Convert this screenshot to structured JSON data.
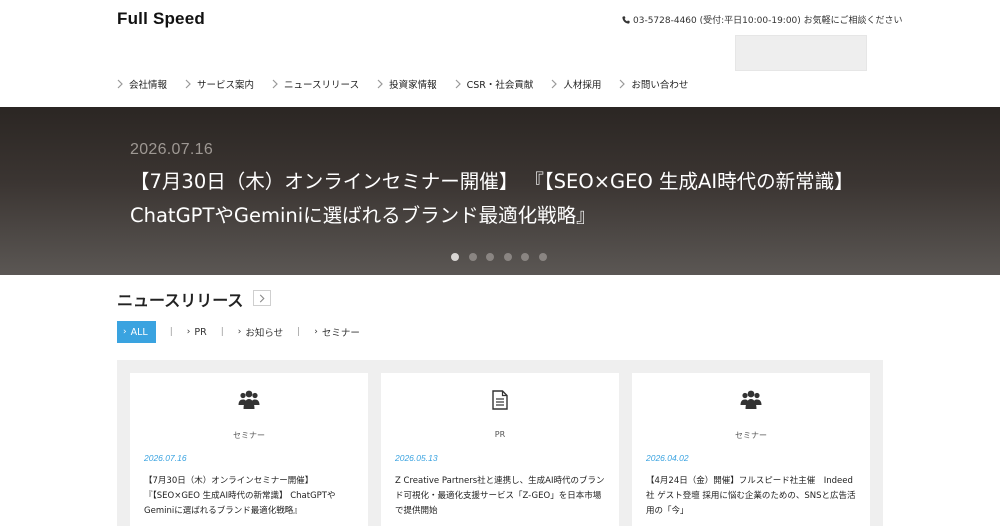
{
  "header": {
    "logo": "Full Speed",
    "contact": "03-5728-4460 (受付:平日10:00-19:00) お気軽にご相談ください"
  },
  "nav": {
    "items": [
      "会社情報",
      "サービス案内",
      "ニュースリリース",
      "投資家情報",
      "CSR・社会貢献",
      "人材採用",
      "お問い合わせ"
    ]
  },
  "hero": {
    "date": "2026.07.16",
    "title": "【7月30日（木）オンラインセミナー開催】 『【SEO×GEO 生成AI時代の新常識】 ChatGPTやGeminiに選ばれるブランド最適化戦略』",
    "slide_count": 6,
    "active_slide": 1
  },
  "news": {
    "title": "ニュースリリース",
    "filters": [
      "ALL",
      "PR",
      "お知らせ",
      "セミナー"
    ],
    "active_filter": "ALL",
    "cards": [
      {
        "icon": "people-icon",
        "category": "セミナー",
        "date": "2026.07.16",
        "title": "【7月30日（木）オンラインセミナー開催】 『【SEO×GEO 生成AI時代の新常識】 ChatGPTやGeminiに選ばれるブランド最適化戦略』"
      },
      {
        "icon": "document-icon",
        "category": "PR",
        "date": "2026.05.13",
        "title": "Z Creative Partners社と連携し、生成AI時代のブランド可視化・最適化支援サービス「Z-GEO」を日本市場で提供開始"
      },
      {
        "icon": "people-icon",
        "category": "セミナー",
        "date": "2026.04.02",
        "title": "【4月24日（金）開催】フルスピード社主催　Indeed社 ゲスト登壇 採用に悩む企業のための、SNSと広告活用の「今」"
      }
    ]
  },
  "colors": {
    "accent": "#3aa3e0",
    "hero_top": "#2b2623",
    "hero_bottom": "#5b5754",
    "card_area": "#efefef"
  }
}
